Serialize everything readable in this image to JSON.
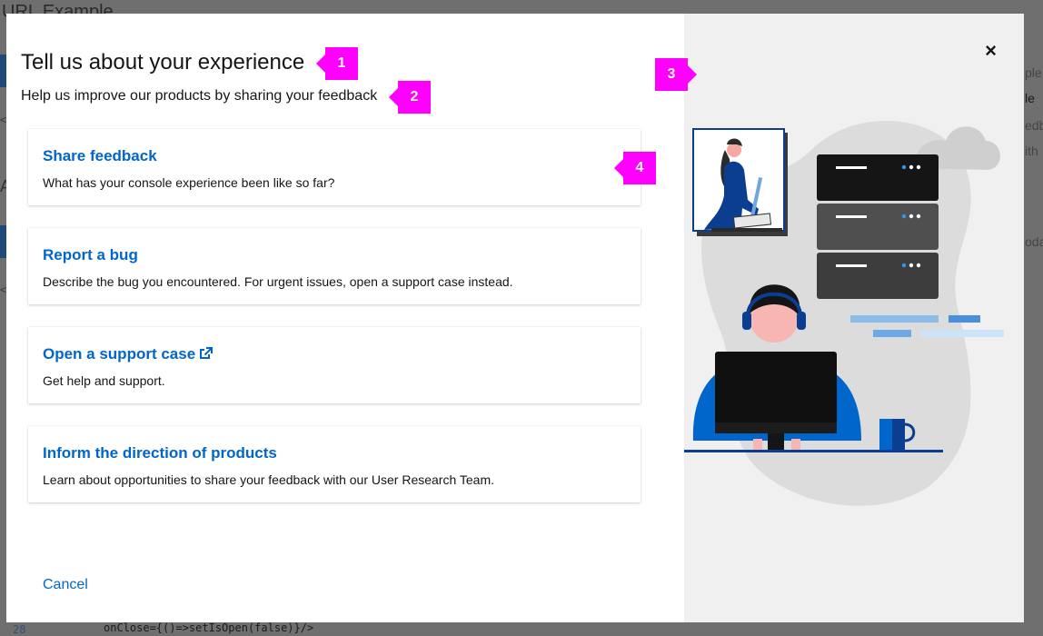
{
  "background": {
    "title": "URL Example",
    "left_letter": "A",
    "right_fragments": [
      "ple",
      "le",
      "edb",
      "ith",
      "oda"
    ],
    "code_line_number": "28",
    "code_line": "onClose={()=>setIsOpen(false)}/>"
  },
  "modal": {
    "title": "Tell us about your experience",
    "subtitle": "Help us improve our products by sharing your feedback",
    "close_symbol": "×",
    "cards": [
      {
        "title": "Share feedback",
        "description": "What has your console experience been like so far?"
      },
      {
        "title": "Report a bug",
        "description": "Describe the bug you encountered. For urgent issues, open a support case instead."
      },
      {
        "title": "Open a support case",
        "description": "Get help and support.",
        "icon": "external-link-icon"
      },
      {
        "title": "Inform the direction of products",
        "description": "Learn about opportunities to share your feedback with our User Research Team."
      }
    ],
    "cancel_label": "Cancel"
  },
  "callouts": [
    "1",
    "2",
    "3",
    "4"
  ],
  "colors": {
    "link_blue": "#0066cc",
    "callout_magenta": "#ff00ff",
    "text_dark": "#151515",
    "art_background": "#f0f0f0"
  }
}
